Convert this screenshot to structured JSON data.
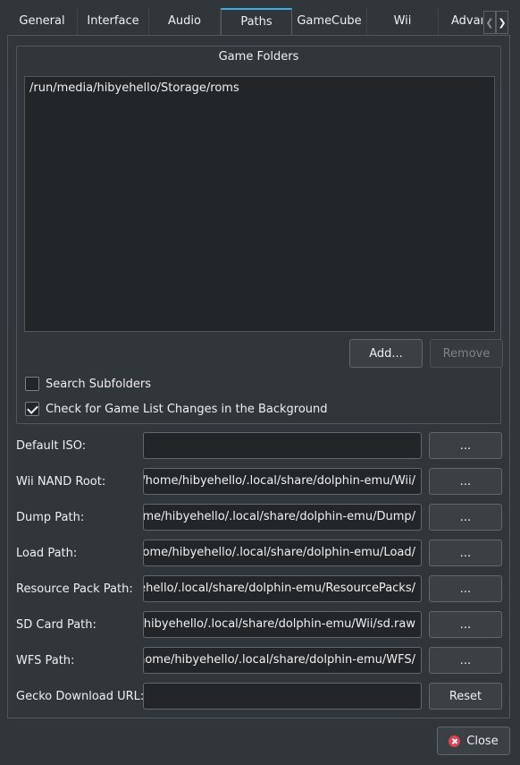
{
  "tabs": [
    {
      "label": "General"
    },
    {
      "label": "Interface"
    },
    {
      "label": "Audio"
    },
    {
      "label": "Paths"
    },
    {
      "label": "GameCube"
    },
    {
      "label": "Wii"
    },
    {
      "label": "Advan"
    }
  ],
  "active_tab": "Paths",
  "game_folders": {
    "title": "Game Folders",
    "items": [
      "/run/media/hibyehello/Storage/roms"
    ],
    "add_label": "Add...",
    "remove_label": "Remove",
    "search_subfolders_label": "Search Subfolders",
    "search_subfolders_checked": false,
    "check_changes_label": "Check for Game List Changes in the Background",
    "check_changes_checked": true
  },
  "paths": {
    "browse_label": "...",
    "default_iso": {
      "label": "Default ISO:",
      "value": ""
    },
    "wii_nand_root": {
      "label": "Wii NAND Root:",
      "value": "/home/hibyehello/.local/share/dolphin-emu/Wii/"
    },
    "dump_path": {
      "label": "Dump Path:",
      "value": "/home/hibyehello/.local/share/dolphin-emu/Dump/"
    },
    "load_path": {
      "label": "Load Path:",
      "value": "/home/hibyehello/.local/share/dolphin-emu/Load/"
    },
    "resource_pack_path": {
      "label": "Resource Pack Path:",
      "value": "/home/hibyehello/.local/share/dolphin-emu/ResourcePacks/"
    },
    "sd_card_path": {
      "label": "SD Card Path:",
      "value": "/home/hibyehello/.local/share/dolphin-emu/Wii/sd.raw"
    },
    "wfs_path": {
      "label": "WFS Path:",
      "value": "/home/hibyehello/.local/share/dolphin-emu/WFS/"
    },
    "gecko_url": {
      "label": "Gecko Download URL:",
      "value": ""
    },
    "reset_label": "Reset"
  },
  "close_label": "Close",
  "colors": {
    "accent": "#3daee9",
    "close_icon": "#da4453"
  }
}
